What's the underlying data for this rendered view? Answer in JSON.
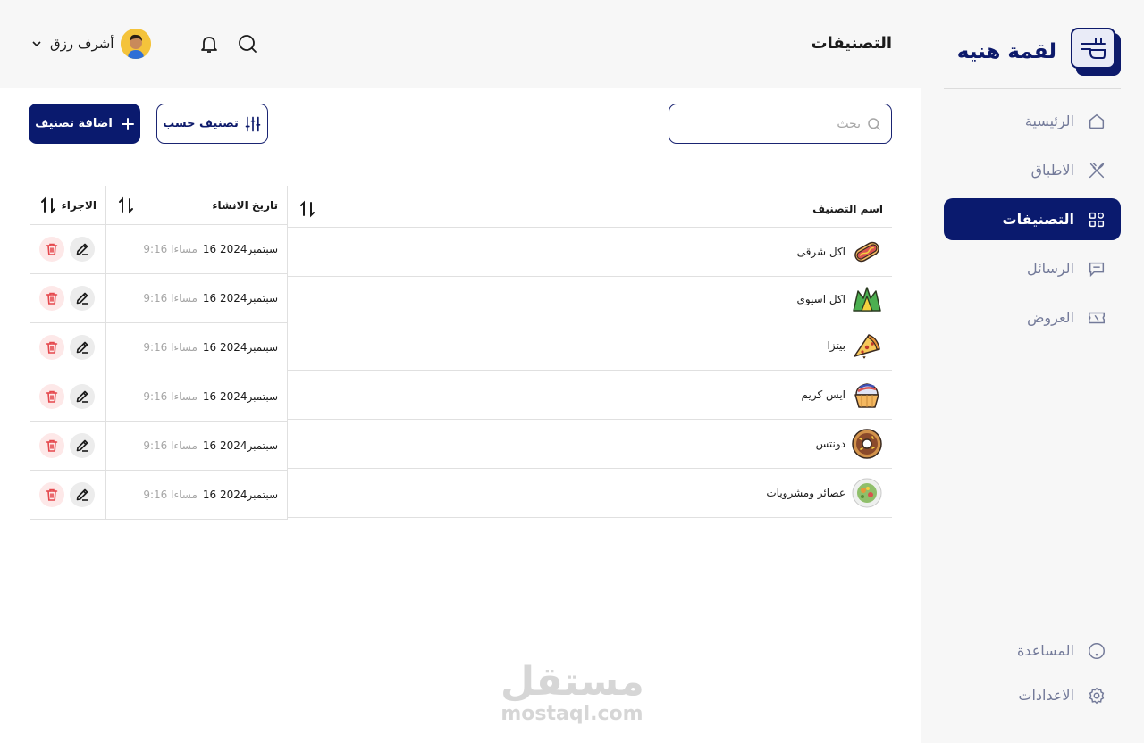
{
  "brand": {
    "name": "لقمة هنيه"
  },
  "sidebar": {
    "items": [
      {
        "label": "الرئيسية",
        "icon": "home-icon"
      },
      {
        "label": "الاطباق",
        "icon": "utensils-icon"
      },
      {
        "label": "التصنيفات",
        "icon": "categories-icon",
        "active": true
      },
      {
        "label": "الرسائل",
        "icon": "message-icon"
      },
      {
        "label": "العروض",
        "icon": "ticket-icon"
      }
    ],
    "bottom": [
      {
        "label": "المساعدة",
        "icon": "help-icon"
      },
      {
        "label": "الاعدادات",
        "icon": "gear-icon"
      }
    ]
  },
  "header": {
    "title": "التصنيفات",
    "user_name": "أشرف رزق"
  },
  "toolbar": {
    "search_placeholder": "بحث",
    "filter_label": "تصنيف حسب",
    "add_label": "اضافة تصنيف"
  },
  "table": {
    "headers": {
      "name": "اسم التصنيف",
      "date": "تاريخ الانشاء",
      "actions": "الاجراء"
    },
    "rows": [
      {
        "name": "اكل شرقى",
        "icon": "hotdog-icon",
        "date": "16 سبتمبر2024",
        "time": "9:16 مساءا"
      },
      {
        "name": "اكل اسيوى",
        "icon": "asian-food-icon",
        "date": "16 سبتمبر2024",
        "time": "9:16 مساءا"
      },
      {
        "name": "بيتزا",
        "icon": "pizza-icon",
        "date": "16 سبتمبر2024",
        "time": "9:16 مساءا"
      },
      {
        "name": "ايس كريم",
        "icon": "ice-cream-icon",
        "date": "16 سبتمبر2024",
        "time": "9:16 مساءا"
      },
      {
        "name": "دونتس",
        "icon": "donut-icon",
        "date": "16 سبتمبر2024",
        "time": "9:16 مساءا"
      },
      {
        "name": "عصائر ومشروبات",
        "icon": "drinks-icon",
        "date": "16 سبتمبر2024",
        "time": "9:16 مساءا"
      }
    ]
  },
  "watermark": {
    "arabic": "مستقل",
    "latin": "mostaql.com"
  },
  "colors": {
    "primary": "#0a1a6e",
    "delete": "#e5484d",
    "muted": "#737a99"
  }
}
